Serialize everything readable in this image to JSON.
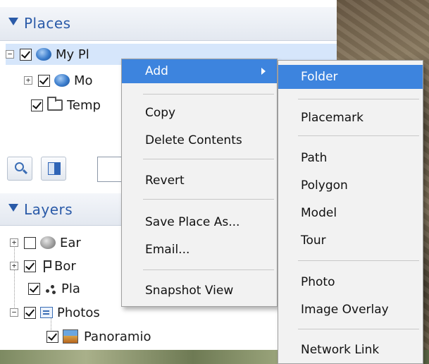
{
  "places_panel": {
    "title": "Places",
    "items": [
      {
        "label": "My Pl",
        "checked": true,
        "expander": "−",
        "icon": "globe-icon"
      },
      {
        "label": "Mo",
        "checked": true,
        "expander": "+",
        "icon": "globe-icon"
      },
      {
        "label": "Temp",
        "checked": true,
        "icon": "folder-icon"
      }
    ]
  },
  "toolbar": {
    "search_icon": "search-icon",
    "panel_icon": "panel-toggle-icon"
  },
  "layers_panel": {
    "title": "Layers",
    "items": [
      {
        "label": "Ear",
        "checked": false,
        "expander": "+",
        "icon": "globe-icon"
      },
      {
        "label": "Bor",
        "checked": true,
        "expander": "+",
        "icon": "pin-icon"
      },
      {
        "label": "Pla",
        "checked": true,
        "icon": "dots-icon"
      },
      {
        "label": "Photos",
        "checked": true,
        "expander": "−",
        "icon": "photos-icon"
      },
      {
        "label": "Panoramio",
        "checked": true,
        "icon": "panoramio-icon"
      }
    ]
  },
  "context_menu": {
    "items": [
      {
        "label": "Add",
        "highlight": true,
        "has_submenu": true
      },
      {
        "label": "Copy"
      },
      {
        "label": "Delete Contents"
      },
      {
        "label": "Revert"
      },
      {
        "label": "Save Place As..."
      },
      {
        "label": "Email..."
      },
      {
        "label": "Snapshot View"
      }
    ]
  },
  "submenu": {
    "items": [
      {
        "label": "Folder",
        "highlight": true
      },
      {
        "label": "Placemark"
      },
      {
        "label": "Path"
      },
      {
        "label": "Polygon"
      },
      {
        "label": "Model"
      },
      {
        "label": "Tour"
      },
      {
        "label": "Photo"
      },
      {
        "label": "Image Overlay"
      },
      {
        "label": "Network Link"
      }
    ]
  },
  "colors": {
    "accent": "#3d84de",
    "header_text": "#2a5aa8",
    "selection": "#d6e6fb"
  }
}
